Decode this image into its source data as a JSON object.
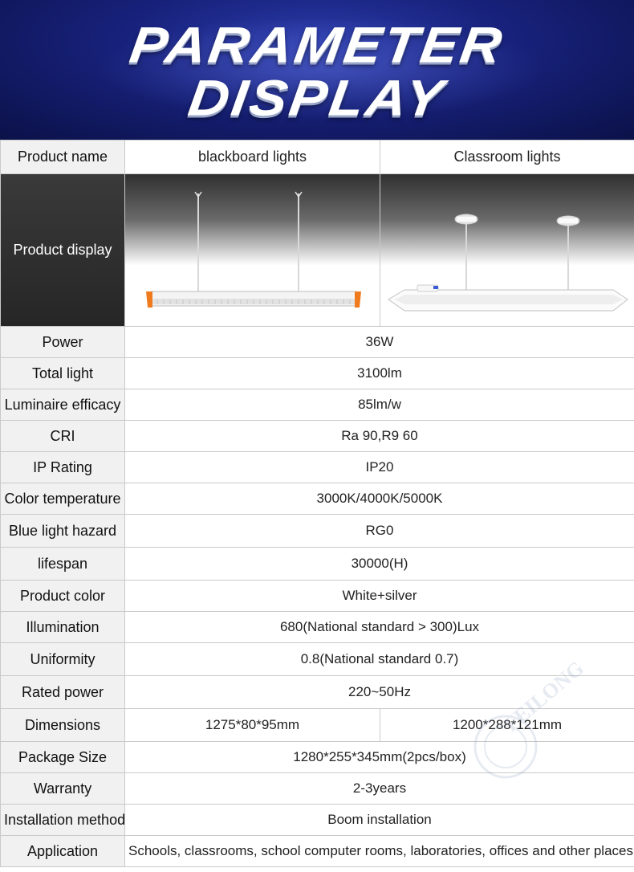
{
  "banner": {
    "title_line1": "PARAMETER",
    "title_line2": "DISPLAY"
  },
  "table": {
    "header": {
      "label": "Product name",
      "col1": "blackboard lights",
      "col2": "Classroom lights"
    },
    "display_label": "Product display",
    "rows": [
      {
        "label": "Power",
        "value": "36W"
      },
      {
        "label": "Total light",
        "value": "3100lm"
      },
      {
        "label": "Luminaire efficacy",
        "value": "85lm/w"
      },
      {
        "label": "CRI",
        "value": "Ra 90,R9 60"
      },
      {
        "label": "IP Rating",
        "value": "IP20"
      },
      {
        "label": "Color temperature",
        "value": "3000K/4000K/5000K"
      },
      {
        "label": "Blue light hazard",
        "value": "RG0"
      },
      {
        "label": "lifespan",
        "value": "30000(H)"
      },
      {
        "label": "Product color",
        "value": "White+silver"
      },
      {
        "label": "Illumination",
        "value": "680(National standard > 300)Lux"
      },
      {
        "label": "Uniformity",
        "value": "0.8(National standard 0.7)"
      },
      {
        "label": "Rated power",
        "value": "220~50Hz"
      }
    ],
    "dimensions": {
      "label": "Dimensions",
      "col1": "1275*80*95mm",
      "col2": "1200*288*121mm"
    },
    "rows2": [
      {
        "label": "Package Size",
        "value": "1280*255*345mm(2pcs/box)"
      },
      {
        "label": "Warranty",
        "value": "2-3years"
      },
      {
        "label": "Installation method",
        "value": "Boom installation"
      },
      {
        "label": "Application",
        "value": "Schools, classrooms, school computer rooms, laboratories, offices and other places."
      }
    ]
  },
  "watermark": {
    "text": "FEILONG"
  },
  "colors": {
    "banner_dark": "#0b1148",
    "banner_mid": "#17217a",
    "label_bg": "#f1f1f1",
    "border": "#c9c9c9",
    "accent_orange": "#f07a1e"
  }
}
